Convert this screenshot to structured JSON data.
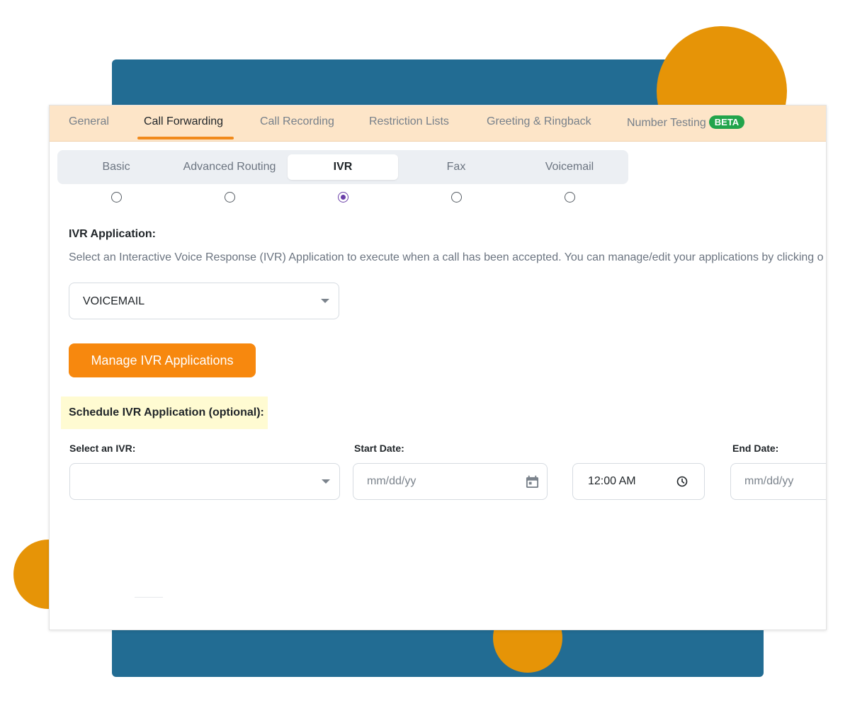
{
  "top_tabs": [
    {
      "label": "General"
    },
    {
      "label": "Call Forwarding",
      "active": true
    },
    {
      "label": "Call Recording"
    },
    {
      "label": "Restriction Lists"
    },
    {
      "label": "Greeting & Ringback"
    },
    {
      "label": "Number Testing",
      "badge": "BETA"
    }
  ],
  "sub_tabs": [
    {
      "label": "Basic"
    },
    {
      "label": "Advanced Routing"
    },
    {
      "label": "IVR",
      "active": true
    },
    {
      "label": "Fax"
    },
    {
      "label": "Voicemail"
    }
  ],
  "ivr": {
    "title": "IVR Application:",
    "description": "Select an Interactive Voice Response (IVR) Application to execute when a call has been accepted. You can manage/edit your applications by clicking o",
    "selected_application": "VOICEMAIL",
    "manage_button": "Manage IVR Applications"
  },
  "schedule": {
    "title": "Schedule IVR Application (optional):",
    "select_label": "Select an IVR:",
    "select_value": "",
    "start_label": "Start Date:",
    "start_placeholder": "mm/dd/yy",
    "start_time": "12:00 AM",
    "end_label": "End Date:",
    "end_placeholder": "mm/dd/yy"
  },
  "colors": {
    "background_panel": "#226c93",
    "accent_circle": "#e69407",
    "tab_bar": "#fde5c8",
    "tab_underline": "#f18a1c",
    "beta_badge": "#22a44b",
    "primary_button": "#f7880e",
    "radio_selected": "#6a3fa8",
    "highlight": "#fffbd2"
  }
}
